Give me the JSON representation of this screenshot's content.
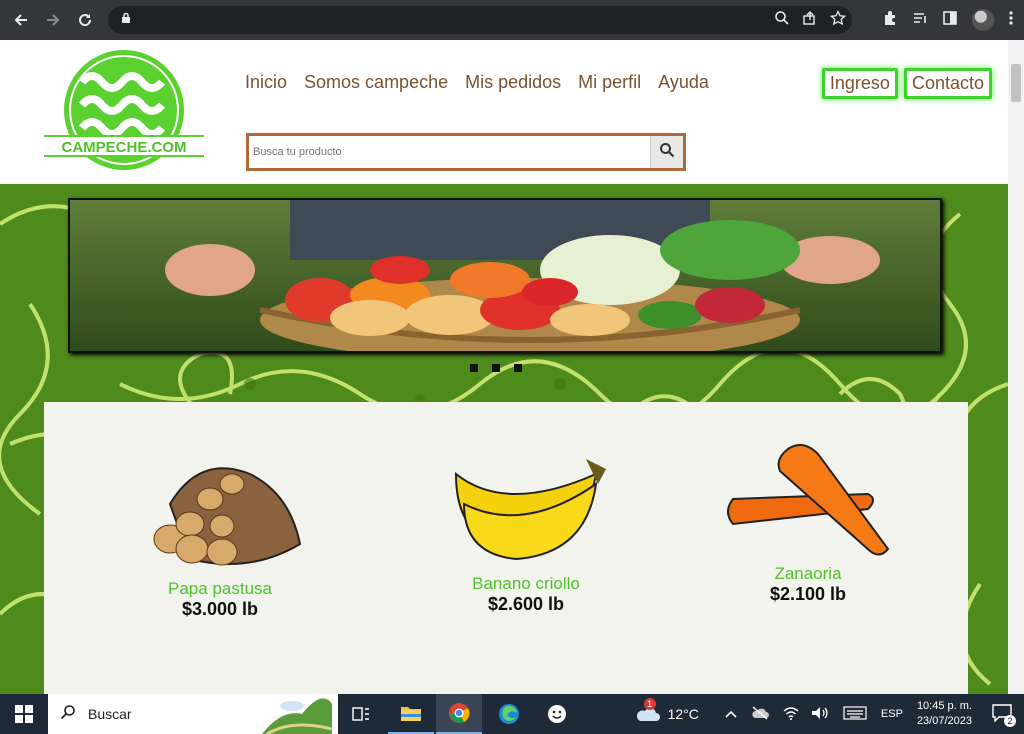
{
  "browser": {
    "address": ""
  },
  "header": {
    "logo_text": "CAMPECHE.COM",
    "menu": [
      "Inicio",
      "Somos campeche",
      "Mis pedidos",
      "Mi perfil",
      "Ayuda"
    ],
    "login_label": "Ingreso",
    "contact_label": "Contacto",
    "search_placeholder": "Busca tu producto"
  },
  "carousel": {
    "slides": 3,
    "active": 1
  },
  "products": [
    {
      "name": "Papa pastusa",
      "price": "$3.000 lb"
    },
    {
      "name": "Banano criollo",
      "price": "$2.600 lb"
    },
    {
      "name": "Zanaoria",
      "price": "$2.100 lb"
    }
  ],
  "taskbar": {
    "search_label": "Buscar",
    "weather": "12°C",
    "weather_badge": "1",
    "language": "ESP",
    "time": "10:45 p. m.",
    "date": "23/07/2023",
    "notifications": "2"
  },
  "colors": {
    "brand_green": "#3fd12d",
    "menu_brown": "#7a5230",
    "hero_green": "#4f8a1c"
  }
}
